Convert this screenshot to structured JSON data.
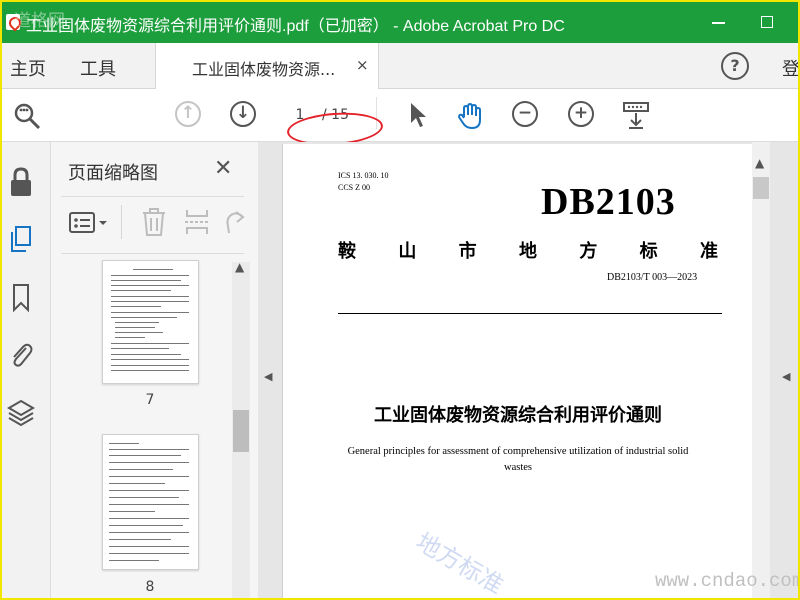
{
  "window": {
    "title": "工业固体废物资源综合利用评价通则.pdf（已加密） - Adobe Acrobat Pro DC",
    "corner_watermark": "道格网"
  },
  "menu": {
    "home": "主页",
    "tools": "工具",
    "login": "登"
  },
  "tab": {
    "label": "工业固体废物资源...",
    "close": "×"
  },
  "toolbar": {
    "current_page": "1",
    "total_pages": "/ 15"
  },
  "thumbnails": {
    "title": "页面缩略图",
    "close": "✕",
    "pages": [
      {
        "number": "7"
      },
      {
        "number": "8"
      }
    ]
  },
  "document": {
    "ics": "ICS   13. 030. 10",
    "ccs": "CCS   Z 00",
    "code": "DB2103",
    "region": [
      "鞍",
      "山",
      "市",
      "地",
      "方",
      "标",
      "准"
    ],
    "std_number": "DB2103/T 003—2023",
    "title_cn": "工业固体废物资源综合利用评价通则",
    "title_en": "General principles for assessment of comprehensive utilization of industrial solid wastes",
    "stamp_watermark": "地方标准"
  },
  "site_watermark": "www.cndao.com",
  "colors": {
    "titlebar": "#1d9e3c",
    "annotation": "#e4222a",
    "frame": "#f2e600"
  }
}
